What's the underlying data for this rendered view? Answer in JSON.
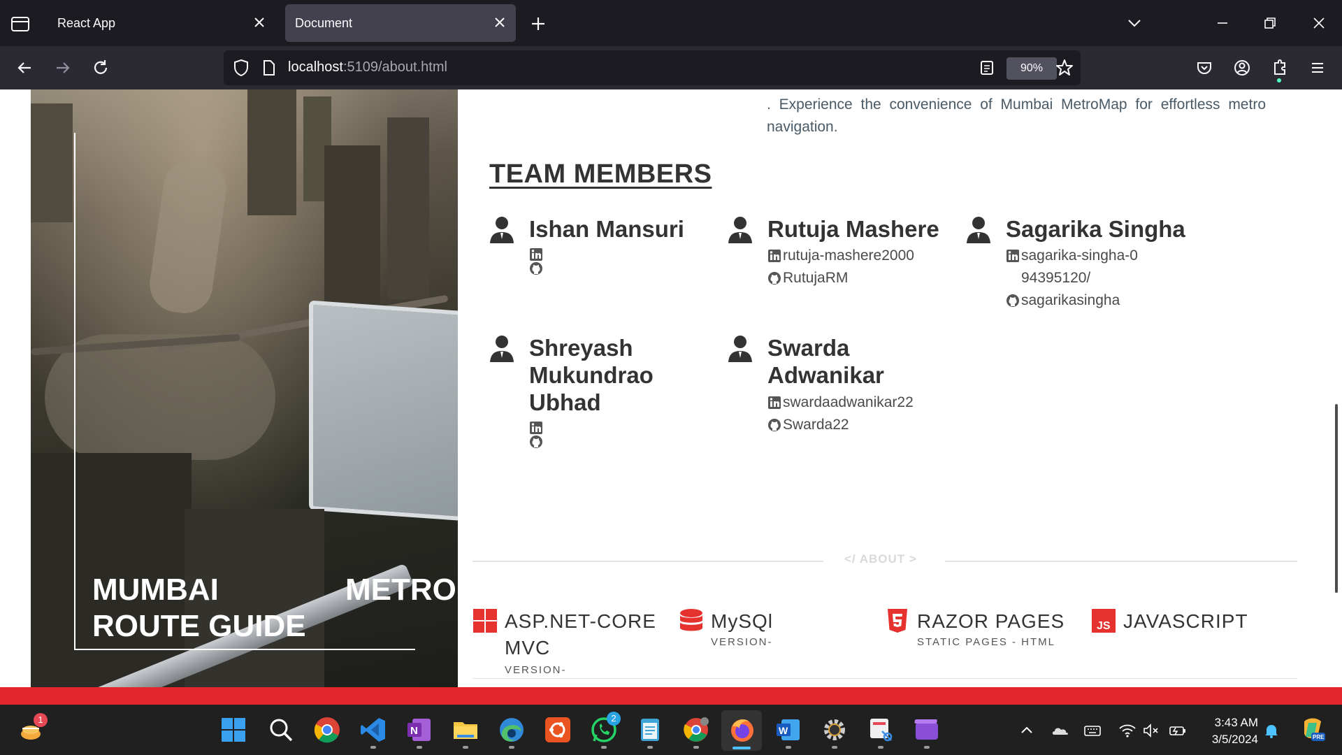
{
  "browser": {
    "tabs": [
      {
        "label": "React App",
        "active": false
      },
      {
        "label": "Document",
        "active": true
      }
    ],
    "url_host": "localhost",
    "url_rest": ":5109/about.html",
    "zoom": "90%"
  },
  "hero": {
    "title_word1": "MUMBAI",
    "title_word2": "METRO",
    "title_line2": "ROUTE GUIDE"
  },
  "intro_text": ". Experience the convenience of Mumbai MetroMap for effortless metro navigation.",
  "team_heading": "TEAM MEMBERS",
  "members": [
    {
      "name": "Ishan Mansuri",
      "linkedin": "",
      "github": ""
    },
    {
      "name": "Rutuja Mashere",
      "linkedin": "rutuja-mashere2000",
      "github": "RutujaRM"
    },
    {
      "name": "Sagarika Singha",
      "linkedin": "sagarika-singha-094395120/",
      "github": "sagarikasingha"
    },
    {
      "name": "Shreyash Mukundrao Ubhad",
      "linkedin": "",
      "github": ""
    },
    {
      "name": "Swarda Adwanikar",
      "linkedin": "swardaadwanikar22",
      "github": "Swarda22"
    }
  ],
  "about_label": "</ ABOUT >",
  "tech": [
    {
      "name": "ASP.NET-CORE MVC",
      "sub": "VERSION-",
      "icon": "windows-icon",
      "color": "#e6322f"
    },
    {
      "name": "MySQl",
      "sub": "VERSION-",
      "icon": "database-icon",
      "color": "#e6322f"
    },
    {
      "name": "RAZOR PAGES",
      "sub": "STATIC PAGES - HTML",
      "icon": "html5-icon",
      "color": "#e6322f"
    },
    {
      "name": "JAVASCRIPT",
      "sub": "",
      "icon": "js-icon",
      "color": "#e6322f"
    }
  ],
  "taskbar": {
    "time": "3:43 AM",
    "date": "3/5/2024",
    "widget_badge": "1",
    "whatsapp_badge": "2"
  },
  "colors": {
    "accent_red": "#e3262c",
    "tab_active": "#42414d",
    "chrome_dark": "#1c1b22"
  }
}
